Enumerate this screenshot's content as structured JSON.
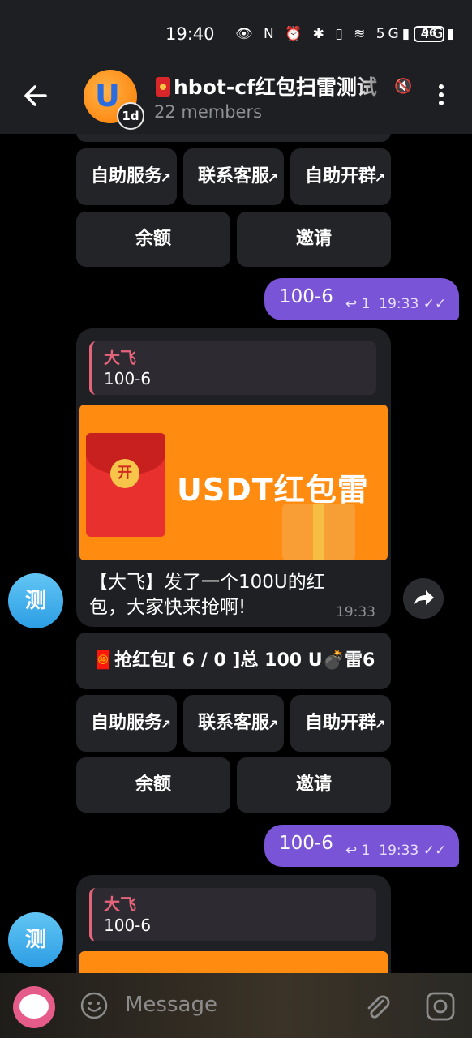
{
  "status_bar": {
    "time": "19:40",
    "icons": "👁 N ⏰ ✱ ▯ ≋ 5G▮ 4G▮",
    "battery": "96"
  },
  "header": {
    "title": "hbot-cf红包扫雷测试",
    "members": "22 members",
    "avatar_letter": "U",
    "timer_badge": "1d"
  },
  "keyboards": {
    "self_service": "自助服务",
    "contact_support": "联系客服",
    "open_group": "自助开群",
    "balance": "余额",
    "invite": "邀请",
    "grab": "🧧抢红包[ 6 / 0 ]总 100 U💣雷6"
  },
  "messages": {
    "out1": {
      "text": "100-6",
      "replies": "1",
      "time": "19:33"
    },
    "in1": {
      "quote_name": "大飞",
      "quote_text": "100-6",
      "banner_text": "USDT红包雷",
      "banner_coin": "开",
      "text": "【大飞】发了一个100U的红包，大家快来抢啊!",
      "time": "19:33"
    },
    "out2": {
      "text": "100-6",
      "replies": "1",
      "time": "19:33"
    },
    "in2": {
      "quote_name": "大飞",
      "quote_text": "100-6"
    }
  },
  "sender_avatar": "测",
  "input": {
    "placeholder": "Message"
  }
}
